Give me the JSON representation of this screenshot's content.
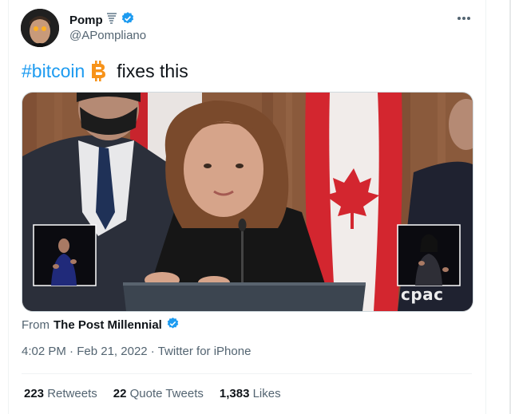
{
  "author": {
    "name": "Pomp",
    "name_emoji": "tornado-emoji",
    "handle": "@APompliano",
    "verified": true
  },
  "tweet": {
    "hashtag": "#bitcoin",
    "emoji": "bitcoin-icon",
    "text_after": "fixes this"
  },
  "media": {
    "watermark": "cpac"
  },
  "source": {
    "prefix": "From",
    "name": "The Post Millennial"
  },
  "meta": {
    "time": "4:02 PM",
    "sep1": "·",
    "date": "Feb 21, 2022",
    "sep2": "·",
    "client": "Twitter for iPhone"
  },
  "stats": {
    "retweets_count": "223",
    "retweets_label": "Retweets",
    "quotes_count": "22",
    "quotes_label": "Quote Tweets",
    "likes_count": "1,383",
    "likes_label": "Likes"
  },
  "colors": {
    "accent": "#1d9bf0",
    "bitcoin": "#f7931a",
    "muted": "#536471"
  }
}
